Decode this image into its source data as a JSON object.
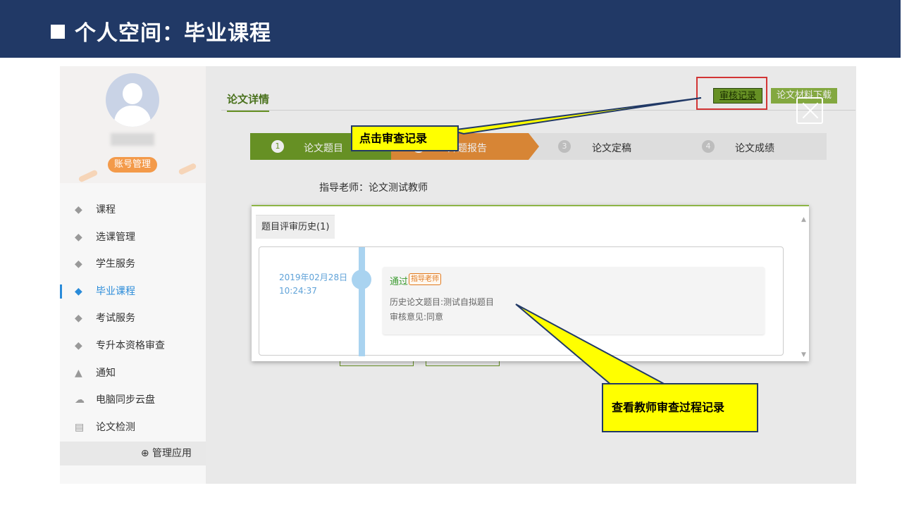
{
  "slide": {
    "title": "个人空间：毕业课程"
  },
  "sidebar": {
    "account_button": "账号管理",
    "items": [
      {
        "label": "课程",
        "icon": "graduation-cap-icon"
      },
      {
        "label": "选课管理",
        "icon": "graduation-cap-icon"
      },
      {
        "label": "学生服务",
        "icon": "graduation-cap-icon"
      },
      {
        "label": "毕业课程",
        "icon": "graduation-cap-icon",
        "active": true
      },
      {
        "label": "考试服务",
        "icon": "graduation-cap-icon"
      },
      {
        "label": "专升本资格审查",
        "icon": "graduation-cap-icon"
      },
      {
        "label": "通知",
        "icon": "bell-icon"
      },
      {
        "label": "电脑同步云盘",
        "icon": "cloud-icon"
      },
      {
        "label": "论文检测",
        "icon": "document-search-icon"
      }
    ],
    "manage_apps": "管理应用"
  },
  "main": {
    "tab": "论文详情",
    "buttons": {
      "review_record": "审核记录",
      "download": "论文材料下载"
    },
    "steps": [
      {
        "num": "1",
        "label": "论文题目"
      },
      {
        "num": "2",
        "label": "开题报告"
      },
      {
        "num": "3",
        "label": "论文定稿"
      },
      {
        "num": "4",
        "label": "论文成绩"
      }
    ],
    "teacher": "指导老师：论文测试教师"
  },
  "modal": {
    "tab": "题目评审历史(1)",
    "entry": {
      "date": "2019年02月28日",
      "time": "10:24:37",
      "status": "通过",
      "role": "指导老师",
      "line1": "历史论文题目:测试自拟题目",
      "line2": "审核意见:同意"
    }
  },
  "callouts": {
    "click": "点击审查记录",
    "view": "查看教师审查过程记录"
  },
  "colors": {
    "header": "#213966",
    "accent_green": "#6e9b27",
    "callout": "#ffff00",
    "highlight": "#e23a3a"
  }
}
